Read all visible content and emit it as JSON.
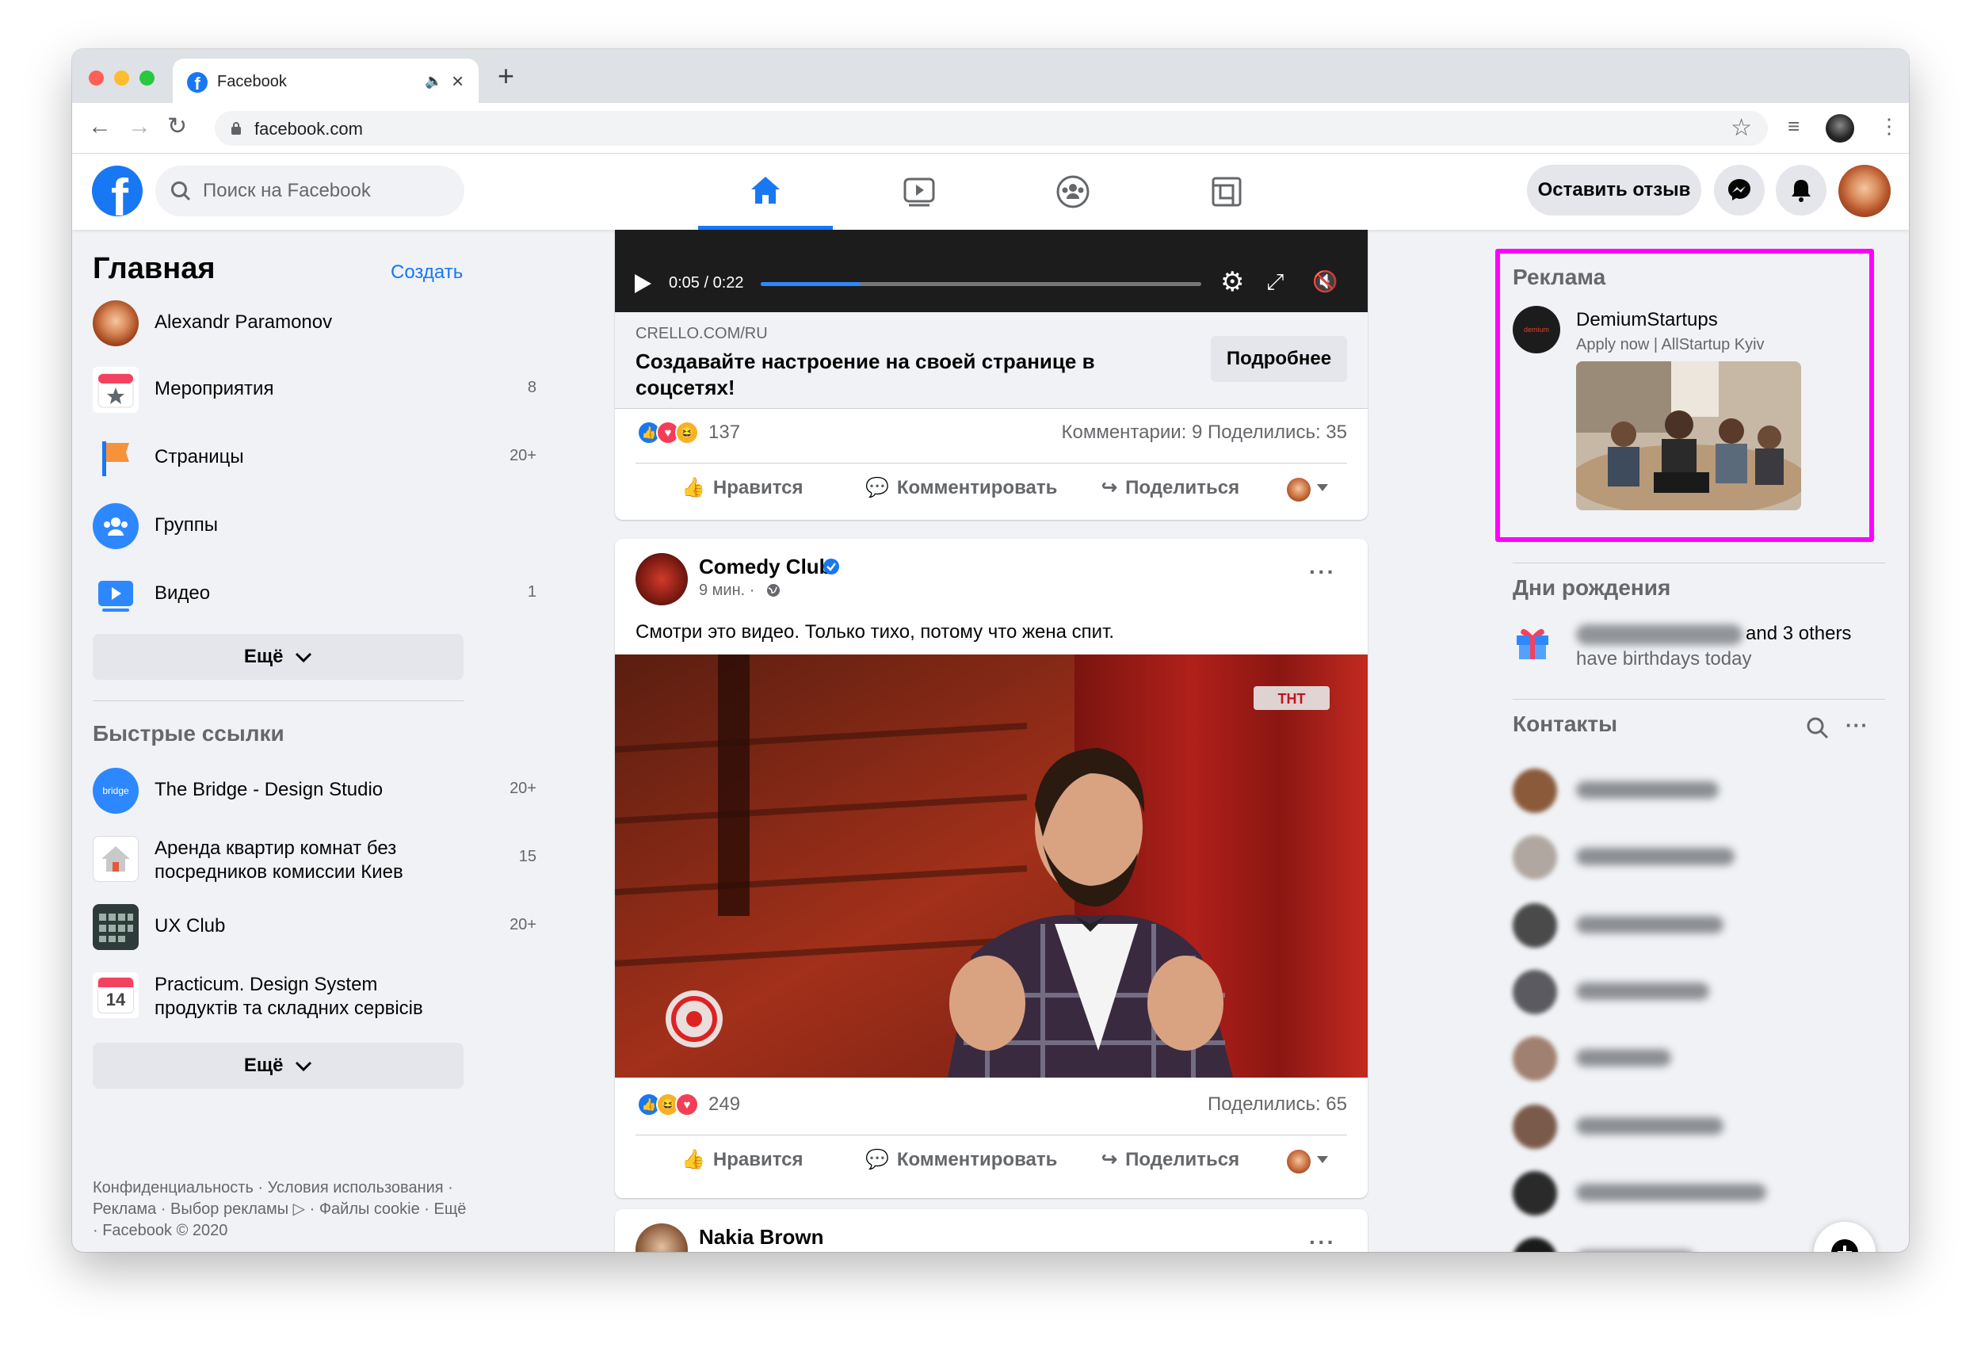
{
  "browser": {
    "tab_title": "Facebook",
    "url": "facebook.com",
    "new_tab": "+"
  },
  "header": {
    "search_placeholder": "Поиск на Facebook",
    "feedback_button": "Оставить отзыв"
  },
  "left": {
    "title": "Главная",
    "create": "Создать",
    "items": [
      {
        "label": "Alexandr Paramonov",
        "count": ""
      },
      {
        "label": "Мероприятия",
        "count": "8"
      },
      {
        "label": "Страницы",
        "count": "20+"
      },
      {
        "label": "Группы",
        "count": ""
      },
      {
        "label": "Видео",
        "count": "1"
      }
    ],
    "more": "Ещё",
    "shortcuts_title": "Быстрые ссылки",
    "shortcuts": [
      {
        "label": "The Bridge - Design Studio",
        "count": "20+",
        "icon_text": "bridge"
      },
      {
        "label": "Аренда квартир комнат без посредников комиссии Киев",
        "count": "15"
      },
      {
        "label": "UX Club",
        "count": "20+"
      },
      {
        "label": "Practicum. Design System продуктів та складних сервісів",
        "count": "",
        "icon_text": "14"
      }
    ],
    "more2": "Ещё",
    "footer": "Конфиденциальность · Условия использования · Реклама · Выбор рекламы ▷ · Файлы cookie · Ещё · Facebook © 2020"
  },
  "post1": {
    "time": "0:05 / 0:22",
    "progress": 0.227,
    "link_domain": "CRELLO.COM/RU",
    "link_title": "Создавайте настроение на своей странице в соцсетях!",
    "cta": "Подробнее",
    "reactions": "137",
    "stats": "Комментарии: 9  Поделились: 35"
  },
  "post2": {
    "author": "Comedy Club",
    "time": "9 мин. ·",
    "text": "Смотри это видео. Только тихо, потому что жена спит.",
    "reactions": "249",
    "stats": "Поделились: 65"
  },
  "post3": {
    "author": "Nakia Brown"
  },
  "actions": {
    "like": "Нравится",
    "comment": "Комментировать",
    "share": "Поделиться"
  },
  "right": {
    "ads_title": "Реклама",
    "ad_name": "DemiumStartups",
    "ad_sub": "Apply now | AllStartup Kyiv",
    "ad_logo": "demium",
    "birthdays_title": "Дни рождения",
    "birthday_rest": "and 3 others",
    "birthday_line2": "have birthdays today",
    "contacts_title": "Контакты"
  },
  "colors": {
    "brand": "#1877f2",
    "highlight": "#ff00ff"
  }
}
